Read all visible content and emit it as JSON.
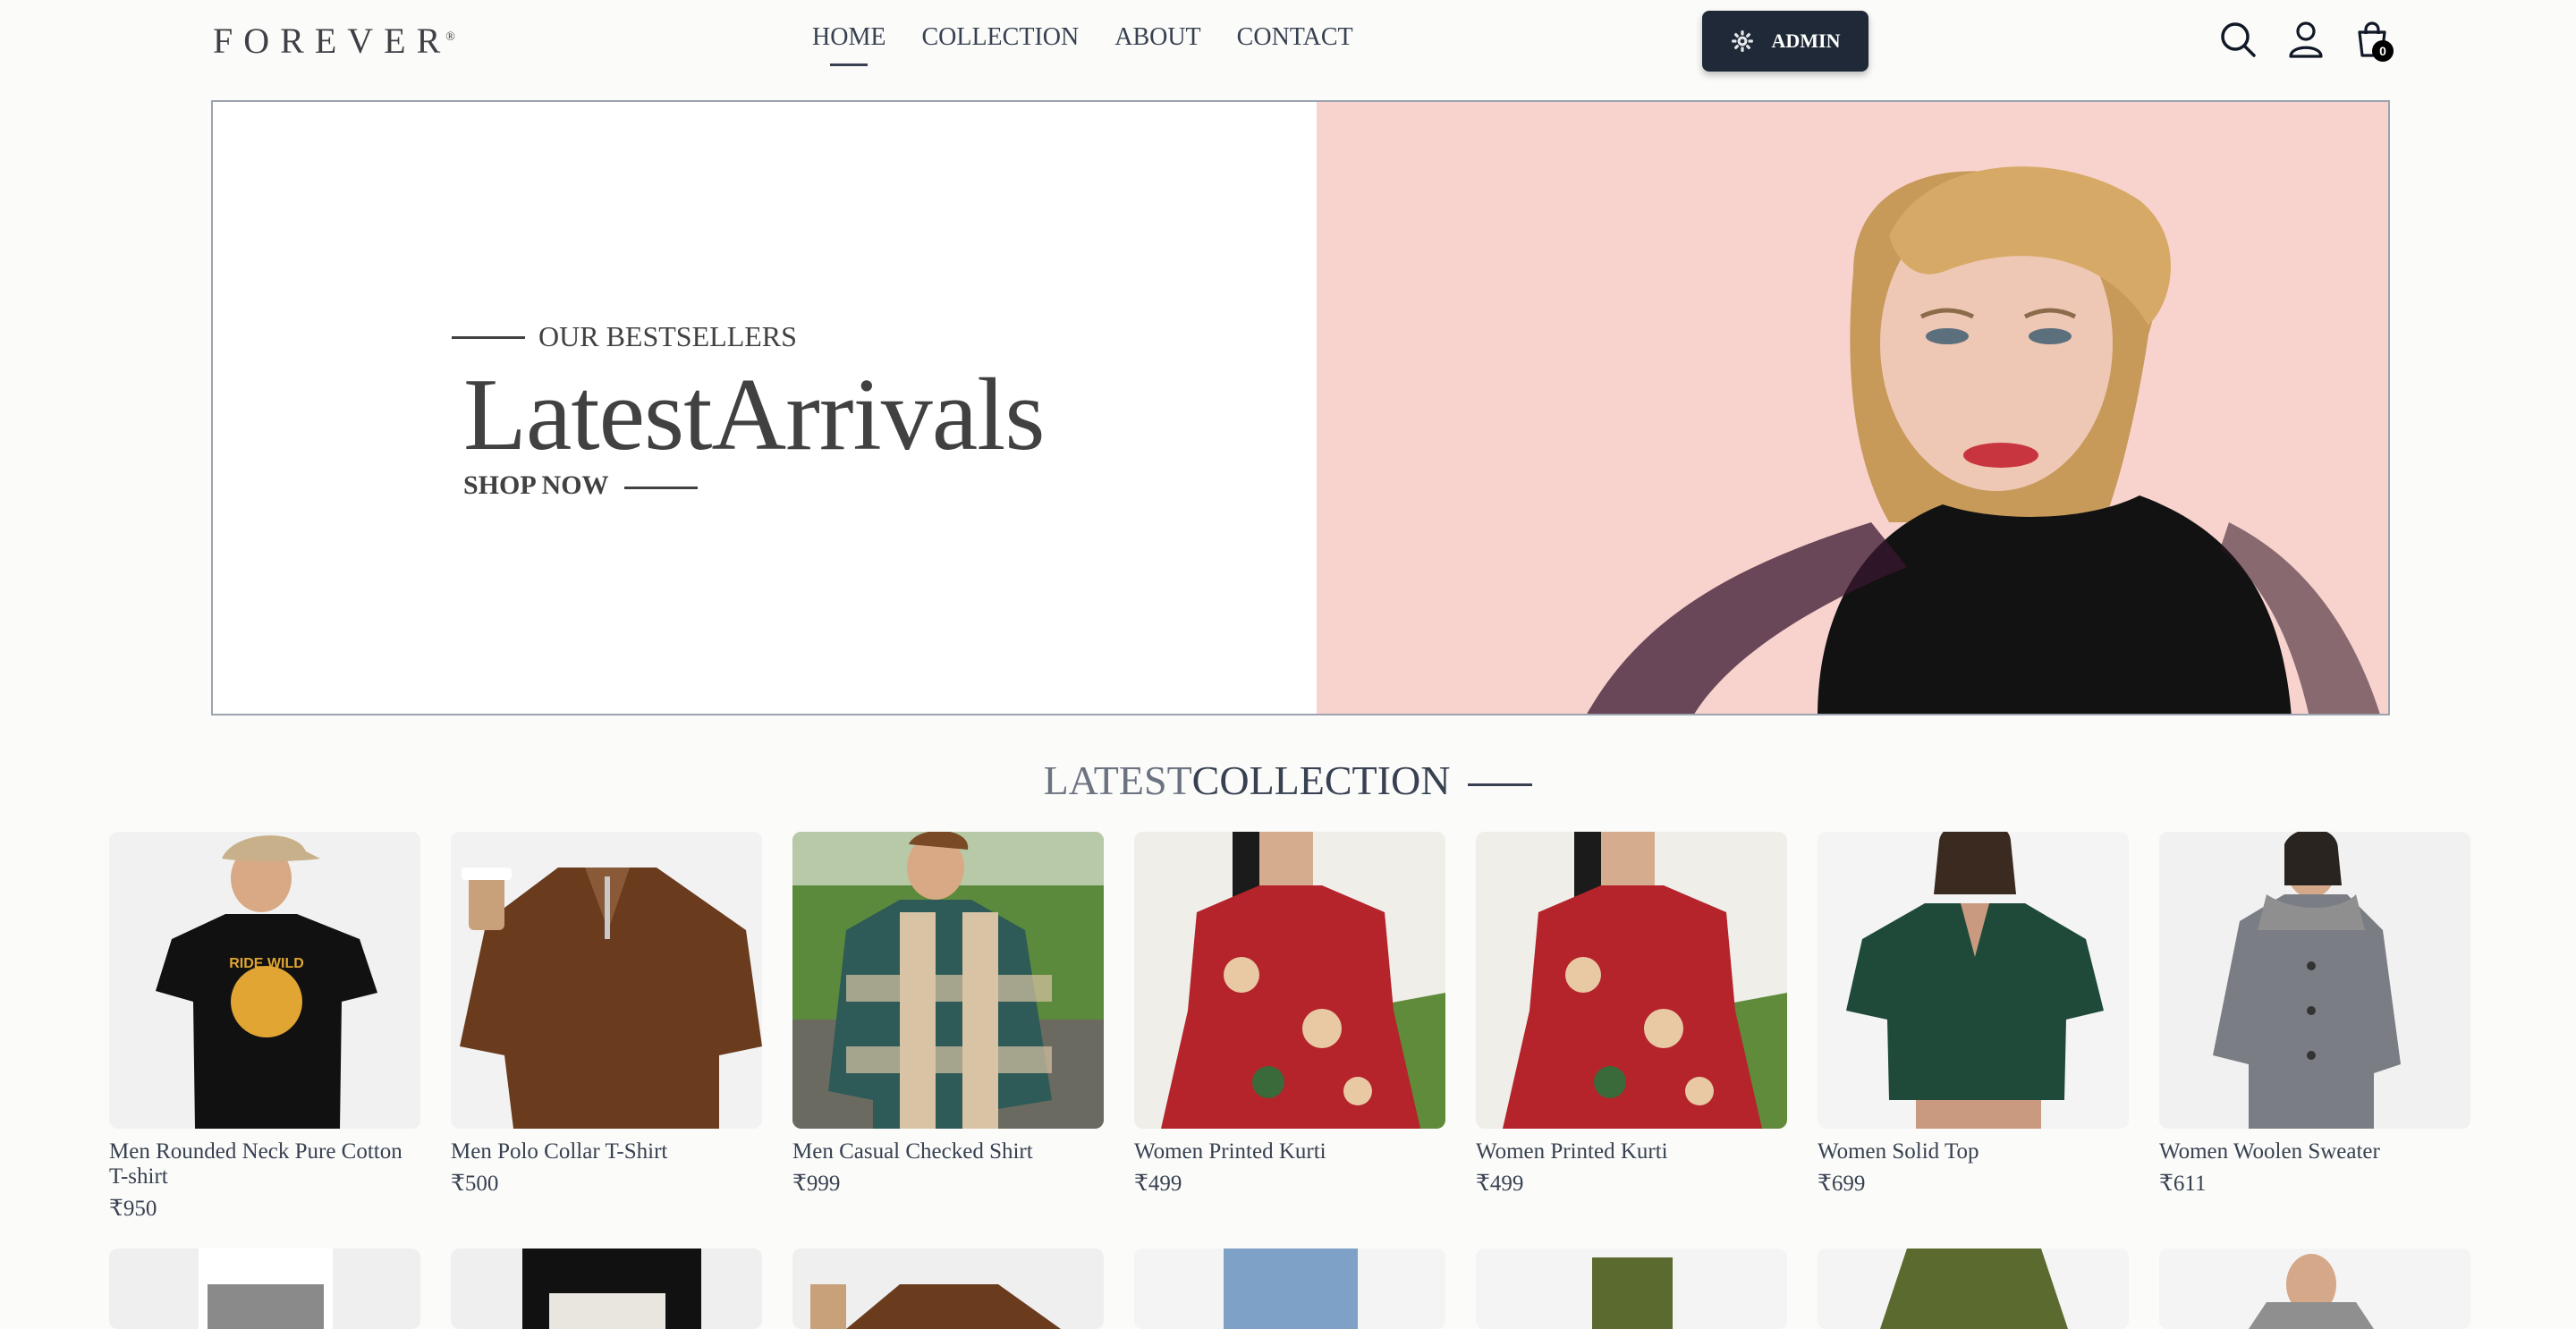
{
  "nav": {
    "logo": "FOREVER",
    "logo_mark": "®",
    "links": [
      "HOME",
      "COLLECTION",
      "ABOUT",
      "CONTACT"
    ],
    "active": "HOME",
    "admin_label": "ADMIN",
    "cart_count": "0",
    "icons": [
      "search-icon",
      "profile-icon",
      "cart-icon"
    ]
  },
  "hero": {
    "tagline": "OUR BESTSELLERS",
    "title": "LatestArrivals",
    "cta": "SHOP NOW",
    "bg_color": "#f8d3ce"
  },
  "latest": {
    "title_light": "LATEST",
    "title_bold": "COLLECTION",
    "products": [
      {
        "name": "Men Rounded Neck Pure Cotton T-shirt",
        "price": "₹950"
      },
      {
        "name": "Men Polo Collar T-Shirt",
        "price": "₹500"
      },
      {
        "name": "Men Casual Checked Shirt",
        "price": "₹999"
      },
      {
        "name": "Women Printed Kurti",
        "price": "₹499"
      },
      {
        "name": "Women Printed Kurti",
        "price": "₹499"
      },
      {
        "name": "Women Solid Top",
        "price": "₹699"
      },
      {
        "name": "Women Woolen Sweater",
        "price": "₹611"
      }
    ]
  }
}
